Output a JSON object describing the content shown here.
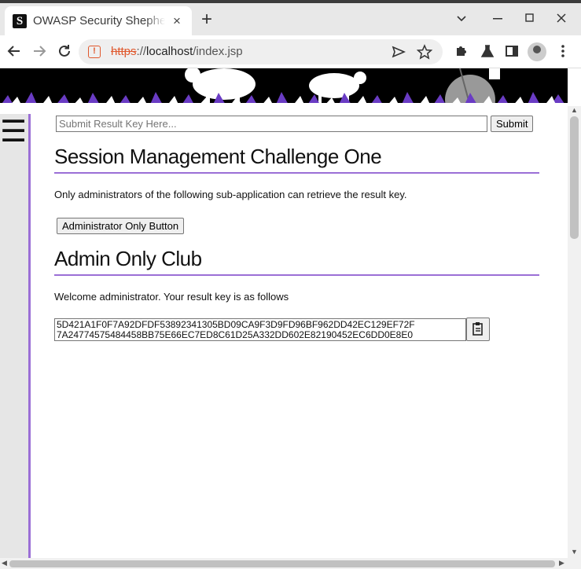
{
  "browser": {
    "tab_title": "OWASP Security Shepherd",
    "favicon_letter": "S",
    "tab_close": "×",
    "new_tab": "+",
    "url_scheme": "https",
    "url_sep": "://",
    "url_host": "localhost",
    "url_path": "/index.jsp",
    "warning_glyph": "!"
  },
  "page": {
    "menu_glyph": "☰",
    "result_key_placeholder": "Submit Result Key Here...",
    "submit_label": "Submit",
    "challenge_title": "Session Management Challenge One",
    "intro_text": "Only administrators of the following sub-application can retrieve the result key.",
    "admin_button_label": "Administrator Only Button",
    "club_title": "Admin Only Club",
    "welcome_text": "Welcome administrator. Your result key is as follows",
    "result_key": "5D421A1F0F7A92DFDF53892341305BD09CA9F3D9FD96BF962DD42EC129EF72F\n7A24774575484458BB75E66EC7ED8C61D25A332DD602E82190452EC6DD0E8E0"
  },
  "colors": {
    "accent": "#9b6fd6",
    "warning": "#e0582d"
  }
}
